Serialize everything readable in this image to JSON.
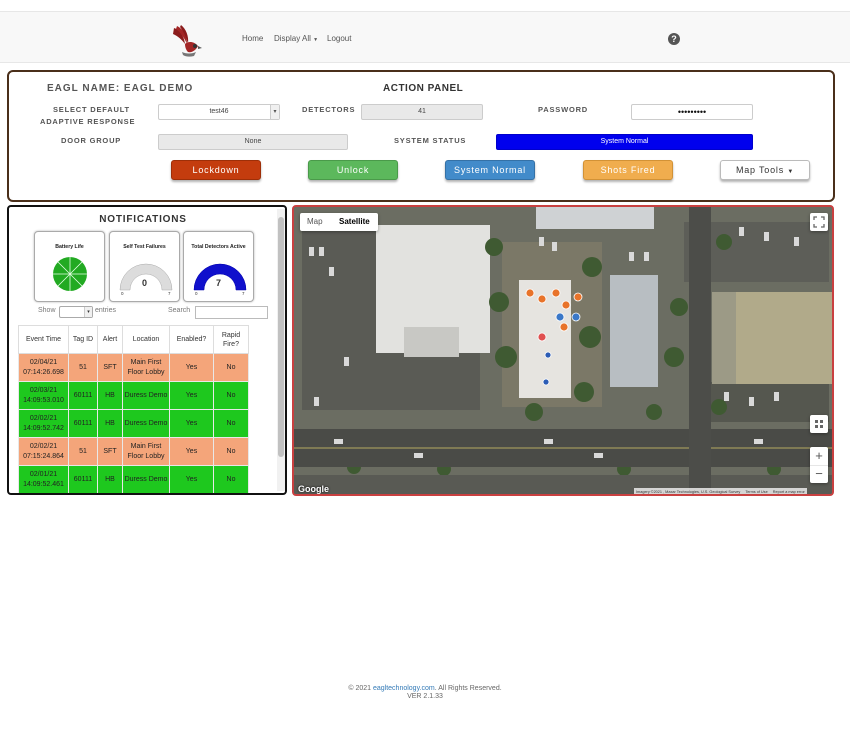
{
  "nav": {
    "home": "Home",
    "display_all": "Display All",
    "logout": "Logout",
    "help": "?"
  },
  "action_panel": {
    "eagl_name": "EAGL NAME: EAGL DEMO",
    "title": "ACTION PANEL",
    "select_default_label_1": "SELECT DEFAULT",
    "select_default_label_2": "ADAPTIVE RESPONSE",
    "select_default_value": "test46",
    "detectors_label": "DETECTORS",
    "detectors_value": "41",
    "password_label": "PASSWORD",
    "password_value": "•••••••••",
    "door_group_label": "DOOR GROUP",
    "door_group_value": "None",
    "system_status_label": "SYSTEM STATUS",
    "system_status_value": "System Normal",
    "buttons": {
      "lockdown": "Lockdown",
      "unlock": "Unlock",
      "system_normal": "System Normal",
      "shots_fired": "Shots Fired",
      "map_tools": "Map Tools"
    }
  },
  "notifications": {
    "title": "NOTIFICATIONS",
    "gauges": {
      "battery_life": {
        "title": "Battery Life"
      },
      "self_test_failures": {
        "title": "Self Test Failures",
        "value": "0",
        "min": "0",
        "max": "7",
        "fraction": 0
      },
      "total_detectors_active": {
        "title": "Total Detectors Active",
        "value": "7",
        "min": "0",
        "max": "7",
        "fraction": 1
      }
    },
    "show_label": "Show",
    "entries_label": "entries",
    "search_label": "Search",
    "columns": [
      "Event Time",
      "Tag ID",
      "Alert",
      "Location",
      "Enabled?",
      "Rapid Fire?"
    ],
    "rows": [
      {
        "time": "02/04/21 07:14:26.698",
        "tag": "51",
        "alert": "SFT",
        "location": "Main First Floor Lobby",
        "enabled": "Yes",
        "rapid": "No",
        "color": "#f4a57a"
      },
      {
        "time": "02/03/21 14:09:53.010",
        "tag": "60111",
        "alert": "HB",
        "location": "Duress Demo",
        "enabled": "Yes",
        "rapid": "No",
        "color": "#1ec81e"
      },
      {
        "time": "02/02/21 14:09:52.742",
        "tag": "60111",
        "alert": "HB",
        "location": "Duress Demo",
        "enabled": "Yes",
        "rapid": "No",
        "color": "#1ec81e"
      },
      {
        "time": "02/02/21 07:15:24.864",
        "tag": "51",
        "alert": "SFT",
        "location": "Main First Floor Lobby",
        "enabled": "Yes",
        "rapid": "No",
        "color": "#f4a57a"
      },
      {
        "time": "02/01/21 14:09:52.461",
        "tag": "60111",
        "alert": "HB",
        "location": "Duress Demo",
        "enabled": "Yes",
        "rapid": "No",
        "color": "#1ec81e"
      }
    ]
  },
  "map": {
    "map_tab": "Map",
    "satellite_tab": "Satellite",
    "google": "Google",
    "attribution": "Imagery ©2021 , Maxar Technologies, U.S. Geological Survey",
    "terms": "Terms of Use",
    "report": "Report a map error",
    "zoom_in": "+",
    "zoom_out": "−"
  },
  "footer": {
    "prefix": "© 2021",
    "link": "eagltechnology.com",
    "suffix": ". All Rights Reserved.",
    "version": "VER 2.1.33"
  },
  "colors": {
    "lockdown": "#c43c0e",
    "unlock": "#5cb85c",
    "system_normal": "#428bca",
    "shots_fired": "#f0ad4e",
    "status_blue": "#0000ee",
    "row_orange": "#f4a57a",
    "row_green": "#1ec81e"
  }
}
